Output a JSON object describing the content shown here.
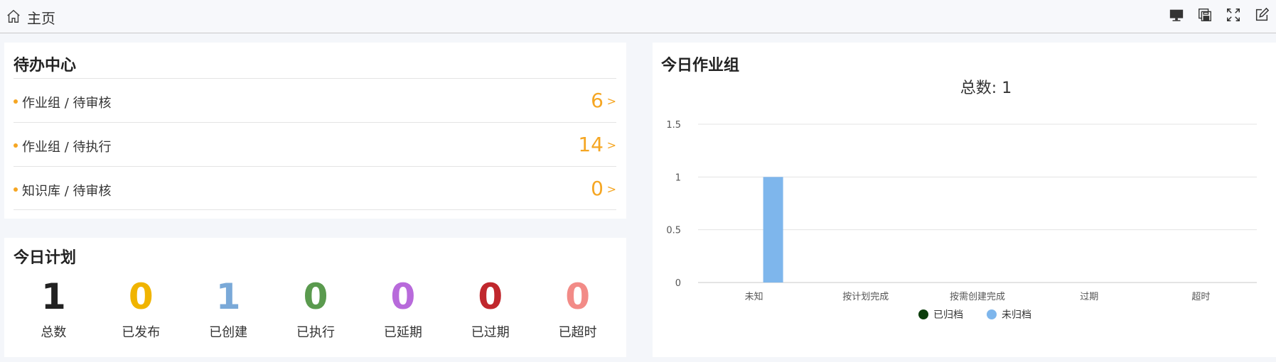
{
  "header": {
    "home_label": "主页",
    "icons": [
      "monitor-icon",
      "save-icon",
      "fullscreen-icon",
      "edit-icon"
    ]
  },
  "pending": {
    "title": "待办中心",
    "items": [
      {
        "label": "作业组 / 待审核",
        "count": "6",
        "arrow": ">"
      },
      {
        "label": "作业组 / 待执行",
        "count": "14",
        "arrow": ">"
      },
      {
        "label": "知识库 / 待审核",
        "count": "0",
        "arrow": ">"
      }
    ],
    "accent": "#f5a623"
  },
  "plan": {
    "title": "今日计划",
    "stats": [
      {
        "value": "1",
        "label": "总数",
        "color": "#222222"
      },
      {
        "value": "0",
        "label": "已发布",
        "color": "#f0b400"
      },
      {
        "value": "1",
        "label": "已创建",
        "color": "#7aa9d8"
      },
      {
        "value": "0",
        "label": "已执行",
        "color": "#5a9a4e"
      },
      {
        "value": "0",
        "label": "已延期",
        "color": "#b86adb"
      },
      {
        "value": "0",
        "label": "已过期",
        "color": "#c0272d"
      },
      {
        "value": "0",
        "label": "已超时",
        "color": "#f28b87"
      }
    ]
  },
  "work": {
    "title": "今日作业组"
  },
  "chart_data": {
    "type": "bar",
    "title": "总数: 1",
    "categories": [
      "未知",
      "按计划完成",
      "按需创建完成",
      "过期",
      "超时"
    ],
    "series": [
      {
        "name": "已归档",
        "values": [
          0,
          0,
          0,
          0,
          0
        ],
        "color": "#0b3d0b"
      },
      {
        "name": "未归档",
        "values": [
          1,
          0,
          0,
          0,
          0
        ],
        "color": "#7eb6ec"
      }
    ],
    "yticks": [
      "0",
      "0.5",
      "1",
      "1.5"
    ],
    "ylim": [
      0,
      1.5
    ],
    "grid": true,
    "legend": "bottom"
  }
}
